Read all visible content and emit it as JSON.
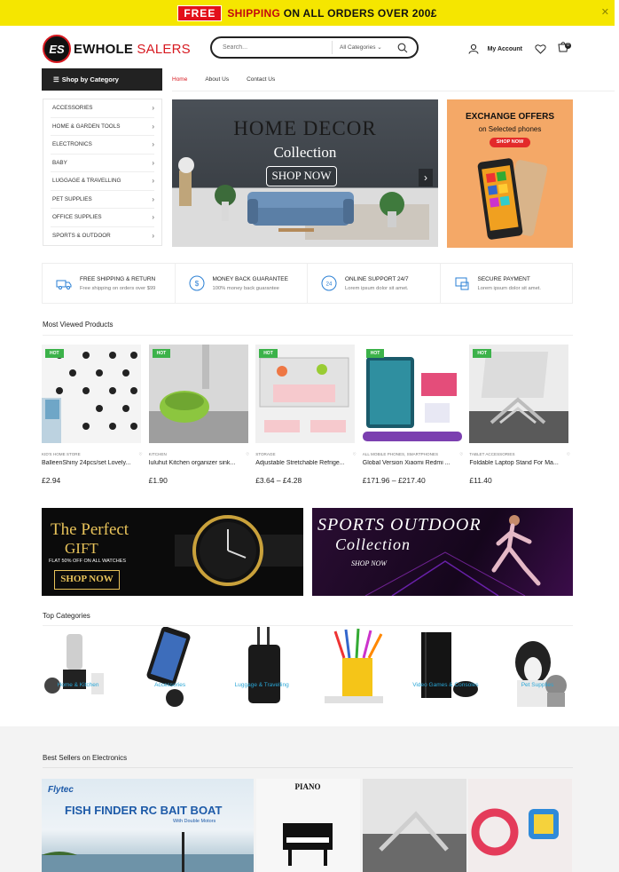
{
  "topbar": {
    "free": "FREE",
    "shipping": "SHIPPING",
    "msg_rest": "ON ALL ORDERS OVER 200£",
    "close": "✕"
  },
  "logo": {
    "mark": "ES",
    "name_a": "EWHOLE",
    "name_b": "SALERS"
  },
  "search": {
    "placeholder": "Search...",
    "category": "All Categories"
  },
  "header": {
    "account": "My Account",
    "cart_count": "0"
  },
  "nav": {
    "shop_by_category": "Shop by Category",
    "links": [
      "Home",
      "About Us",
      "Contact Us"
    ]
  },
  "categories": [
    "ACCESSORIES",
    "HOME & GARDEN TOOLS",
    "ELECTRONICS",
    "BABY",
    "LUGGAGE & TRAVELLING",
    "PET SUPPLIES",
    "OFFICE SUPPLIES",
    "SPORTS & OUTDOOR"
  ],
  "hero": {
    "title": "HOME DECOR",
    "subtitle": "Collection",
    "button": "SHOP NOW"
  },
  "promo": {
    "title": "EXCHANGE OFFERS",
    "subtitle": "on Selected phones",
    "button": "SHOP NOW"
  },
  "features": [
    {
      "title": "FREE SHIPPING & RETURN",
      "sub": "Free shipping on orders over $99"
    },
    {
      "title": "MONEY BACK GUARANTEE",
      "sub": "100% money back guarantee"
    },
    {
      "title": "ONLINE SUPPORT 24/7",
      "sub": "Lorem ipsum dolor sit amet."
    },
    {
      "title": "SECURE PAYMENT",
      "sub": "Lorem ipsum dolor sit amet."
    }
  ],
  "most_viewed": {
    "title": "Most Viewed Products",
    "badge": "HOT",
    "items": [
      {
        "cat": "KID'S HOME STORE",
        "name": "BalleenShiny 24pcs/set Lovely...",
        "price": "£2.94"
      },
      {
        "cat": "KITCHEN",
        "name": "Iuluhut Kitchen organizer sink...",
        "price": "£1.90"
      },
      {
        "cat": "STORAGE",
        "name": "Adjustable Stretchable Refrige...",
        "price": "£3.64 – £4.28"
      },
      {
        "cat": "ALL MOBILE PHONES, SMARTPHONES",
        "name": "Global Version Xiaomi Redmi ...",
        "price": "£171.96 – £217.40"
      },
      {
        "cat": "TABLET ACCESSORIES",
        "name": "Foldable Laptop Stand For Ma...",
        "price": "£11.40"
      }
    ]
  },
  "banner_gift": {
    "line1": "The Perfect",
    "line2": "GIFT",
    "line3": "FLAT 50% OFF ON ALL WATCHES",
    "button": "SHOP NOW"
  },
  "banner_sports": {
    "line1": "SPORTS OUTDOOR",
    "line2": "Collection",
    "button": "SHOP NOW"
  },
  "top_categories": {
    "title": "Top Categories",
    "items": [
      "Home & Kitchen",
      "Accessories",
      "Luggage & Travelling",
      "",
      "Video Games & Consoles",
      "Pet Supplies"
    ]
  },
  "best_sellers": {
    "title": "Best Sellers on Electronics",
    "brand": "Flytec",
    "headline": "FISH FINDER RC BAIT BOAT",
    "sub": "With Double Motors",
    "piano": "PIANO"
  },
  "colors": {
    "accent": "#d71920",
    "banner": "#f5e600",
    "hot": "#3cb24a"
  }
}
